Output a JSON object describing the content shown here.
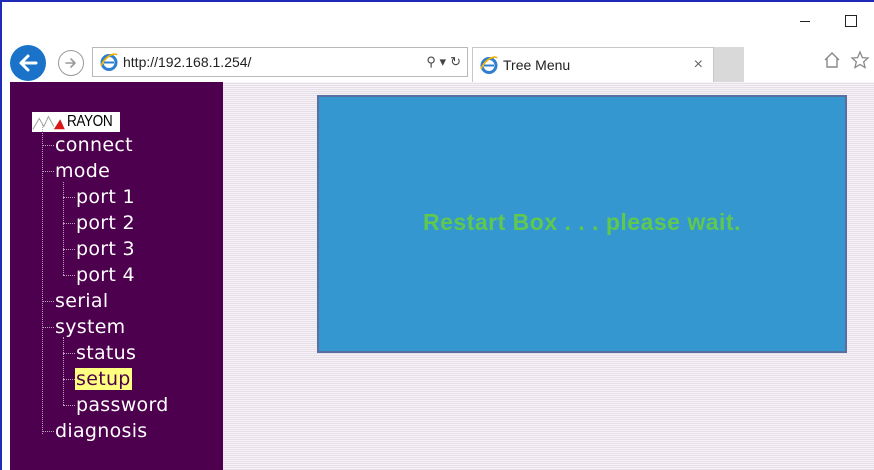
{
  "browser": {
    "url": "http://192.168.1.254/",
    "tab_title": "Tree Menu",
    "tab_close": "×",
    "search_glyph": "⚲ ▾",
    "refresh_glyph": "↻",
    "minimize": "",
    "maximize": ""
  },
  "logo": {
    "text": "RAYON"
  },
  "tree": {
    "items": [
      {
        "label": "connect"
      },
      {
        "label": "mode"
      },
      {
        "label": "port 1"
      },
      {
        "label": "port 2"
      },
      {
        "label": "port 3"
      },
      {
        "label": "port 4"
      },
      {
        "label": "serial"
      },
      {
        "label": "system"
      },
      {
        "label": "status"
      },
      {
        "label": "setup",
        "selected": true
      },
      {
        "label": "password"
      },
      {
        "label": "diagnosis"
      }
    ]
  },
  "main": {
    "message": "Restart Box . . . please wait."
  },
  "colors": {
    "sidebar_bg": "#4d004d",
    "restart_box_bg": "#3597cf",
    "message_text": "#5fc84f",
    "selected_highlight": "#ffff80",
    "window_border": "#1f2bb8"
  }
}
